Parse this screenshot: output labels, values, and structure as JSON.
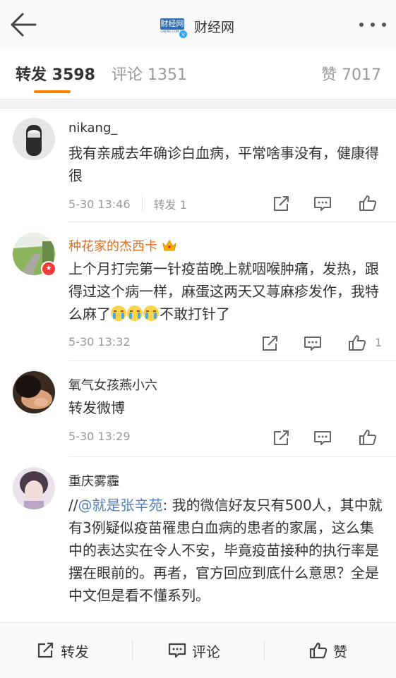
{
  "header": {
    "brand_logo_text": "财经网",
    "brand_logo_sub": "CAIJING.COM.CN",
    "brand_name": "财经网",
    "verified_mark": "v"
  },
  "tabs": {
    "repost": "转发 3598",
    "comment": "评论 1351",
    "like": "赞 7017"
  },
  "reposts": [
    {
      "user": "nikang_",
      "text": "我有亲戚去年确诊白血病，平常啥事没有，健康得很",
      "time": "5-30 13:46",
      "repost_label": "转发 1",
      "likes": ""
    },
    {
      "user": "种花家的杰西卡",
      "text_before": "上个月打完第一针疫苗晚上就咽喉肿痛，发热，跟得过这个病一样，麻蛋这两天又荨麻疹发作，我特么麻了",
      "text_after": "不敢打针了",
      "time": "5-30 13:32",
      "likes": "1"
    },
    {
      "user": "氧气女孩燕小六",
      "text": "转发微博",
      "time": "5-30 13:29",
      "likes": ""
    },
    {
      "user": "重庆雾霾",
      "prefix": "//",
      "mention": "@就是张辛苑",
      "text": ": 我的微信好友只有500人，其中就有3例疑似疫苗罹患白血病的患者的家属，这么集中的表达实在令人不安，毕竟疫苗接种的执行率是摆在眼前的。再者，官方回应到底什么意思？全是中文但是看不懂系列。"
    }
  ],
  "bottom_bar": {
    "repost": "转发",
    "comment": "评论",
    "like": "赞"
  },
  "colors": {
    "accent_orange": "#ff8200",
    "username_orange": "#e86a14",
    "mention_blue": "#5580b8"
  }
}
